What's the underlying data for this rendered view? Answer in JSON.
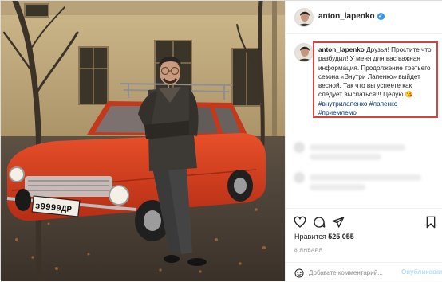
{
  "post": {
    "username": "anton_lapenko",
    "verified_mark": "✓",
    "caption_user": "anton_lapenko",
    "caption_text": "Друзья! Простите что разбудил! У меня для вас важная информация. Продолжение третьего сезона «Внутри Лапенко» выйдет весной. Так что вы успеете как следует выспаться!!! Целую",
    "caption_emoji": "😘",
    "caption_tags": "#внутрилапенко #лапенко #приемлемо"
  },
  "photo": {
    "plate": "з9999ДР"
  },
  "actions": {
    "like_icon": "heart-icon",
    "comment_icon": "comment-icon",
    "share_icon": "share-icon",
    "save_icon": "bookmark-icon"
  },
  "likes": {
    "label": "Нравится",
    "count": "525 055"
  },
  "date": "8 ЯНВАРЯ",
  "comment_form": {
    "placeholder": "Добавьте комментарий...",
    "publish_label": "Опубликовать"
  },
  "colors": {
    "highlight_border": "#d8413c",
    "car_body": "#d63a1c",
    "link": "#003569",
    "publish_disabled": "#b2dffc"
  }
}
